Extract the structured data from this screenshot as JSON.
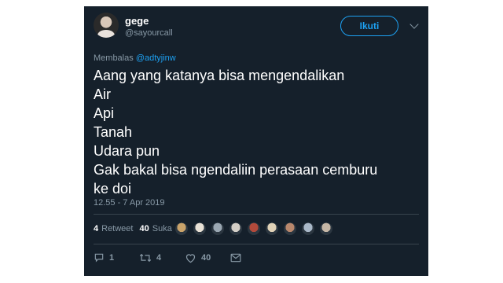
{
  "user": {
    "name": "gege",
    "handle": "@sayourcall"
  },
  "follow_label": "Ikuti",
  "reply": {
    "prefix": "Membalas",
    "mention": "@adtyjinw"
  },
  "tweet_lines": [
    "Aang yang katanya bisa mengendalikan",
    "Air",
    "Api",
    "Tanah",
    "Udara pun",
    "Gak bakal bisa ngendaliin perasaan cemburu",
    "ke doi"
  ],
  "timestamp": "12.55 - 7 Apr 2019",
  "stats": {
    "retweets_count": "4",
    "retweets_label": "Retweet",
    "likes_count": "40",
    "likes_label": "Suka"
  },
  "likers": [
    {
      "color": "#c9a36a"
    },
    {
      "color": "#e8e1d6"
    },
    {
      "color": "#9aa7b2"
    },
    {
      "color": "#d4cfc7"
    },
    {
      "color": "#b24a3b"
    },
    {
      "color": "#e0d2b7"
    },
    {
      "color": "#b8876c"
    },
    {
      "color": "#a9b8c8"
    },
    {
      "color": "#c6b7a6"
    }
  ],
  "actions": {
    "reply_count": "1",
    "retweet_count": "4",
    "like_count": "40"
  },
  "icons": {
    "reply": "reply-icon",
    "retweet": "retweet-icon",
    "like": "heart-icon",
    "dm": "message-icon",
    "more": "chevron-down-icon"
  },
  "colors": {
    "background": "#15202b",
    "accent": "#1da1f2",
    "muted": "#8899a6",
    "divider": "#38444d"
  }
}
